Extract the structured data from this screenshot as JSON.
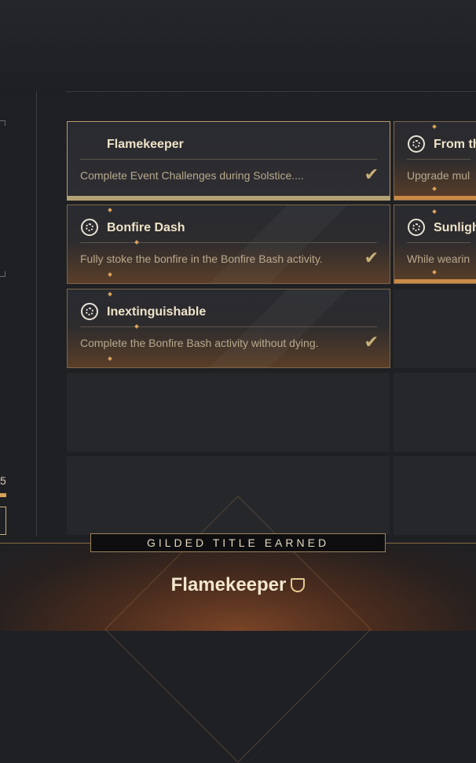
{
  "triumphs": [
    {
      "title": "Flamekeeper",
      "description": "Complete Event Challenges during Solstice....",
      "completed": true,
      "icon": "checkmark-icon"
    },
    {
      "title": "From th",
      "description": "Upgrade mul",
      "completed": false,
      "icon": "solstice-emblem-icon"
    },
    {
      "title": "Bonfire Dash",
      "description": "Fully stoke the bonfire in the Bonfire Bash activity.",
      "completed": true,
      "icon": "solstice-emblem-icon"
    },
    {
      "title": "Sunligh",
      "description": "While wearin",
      "completed": false,
      "icon": "solstice-emblem-icon"
    },
    {
      "title": "Inextinguishable",
      "description": "Complete the Bonfire Bash activity without dying.",
      "completed": true,
      "icon": "solstice-emblem-icon"
    }
  ],
  "left_panel": {
    "count": "5"
  },
  "footer": {
    "banner": "GILDED TITLE EARNED",
    "title": "Flamekeeper",
    "title_icon": "gilded-seal-icon"
  },
  "colors": {
    "accent": "#d9a15a",
    "gold": "#c8b07a",
    "background": "#1f2024"
  }
}
